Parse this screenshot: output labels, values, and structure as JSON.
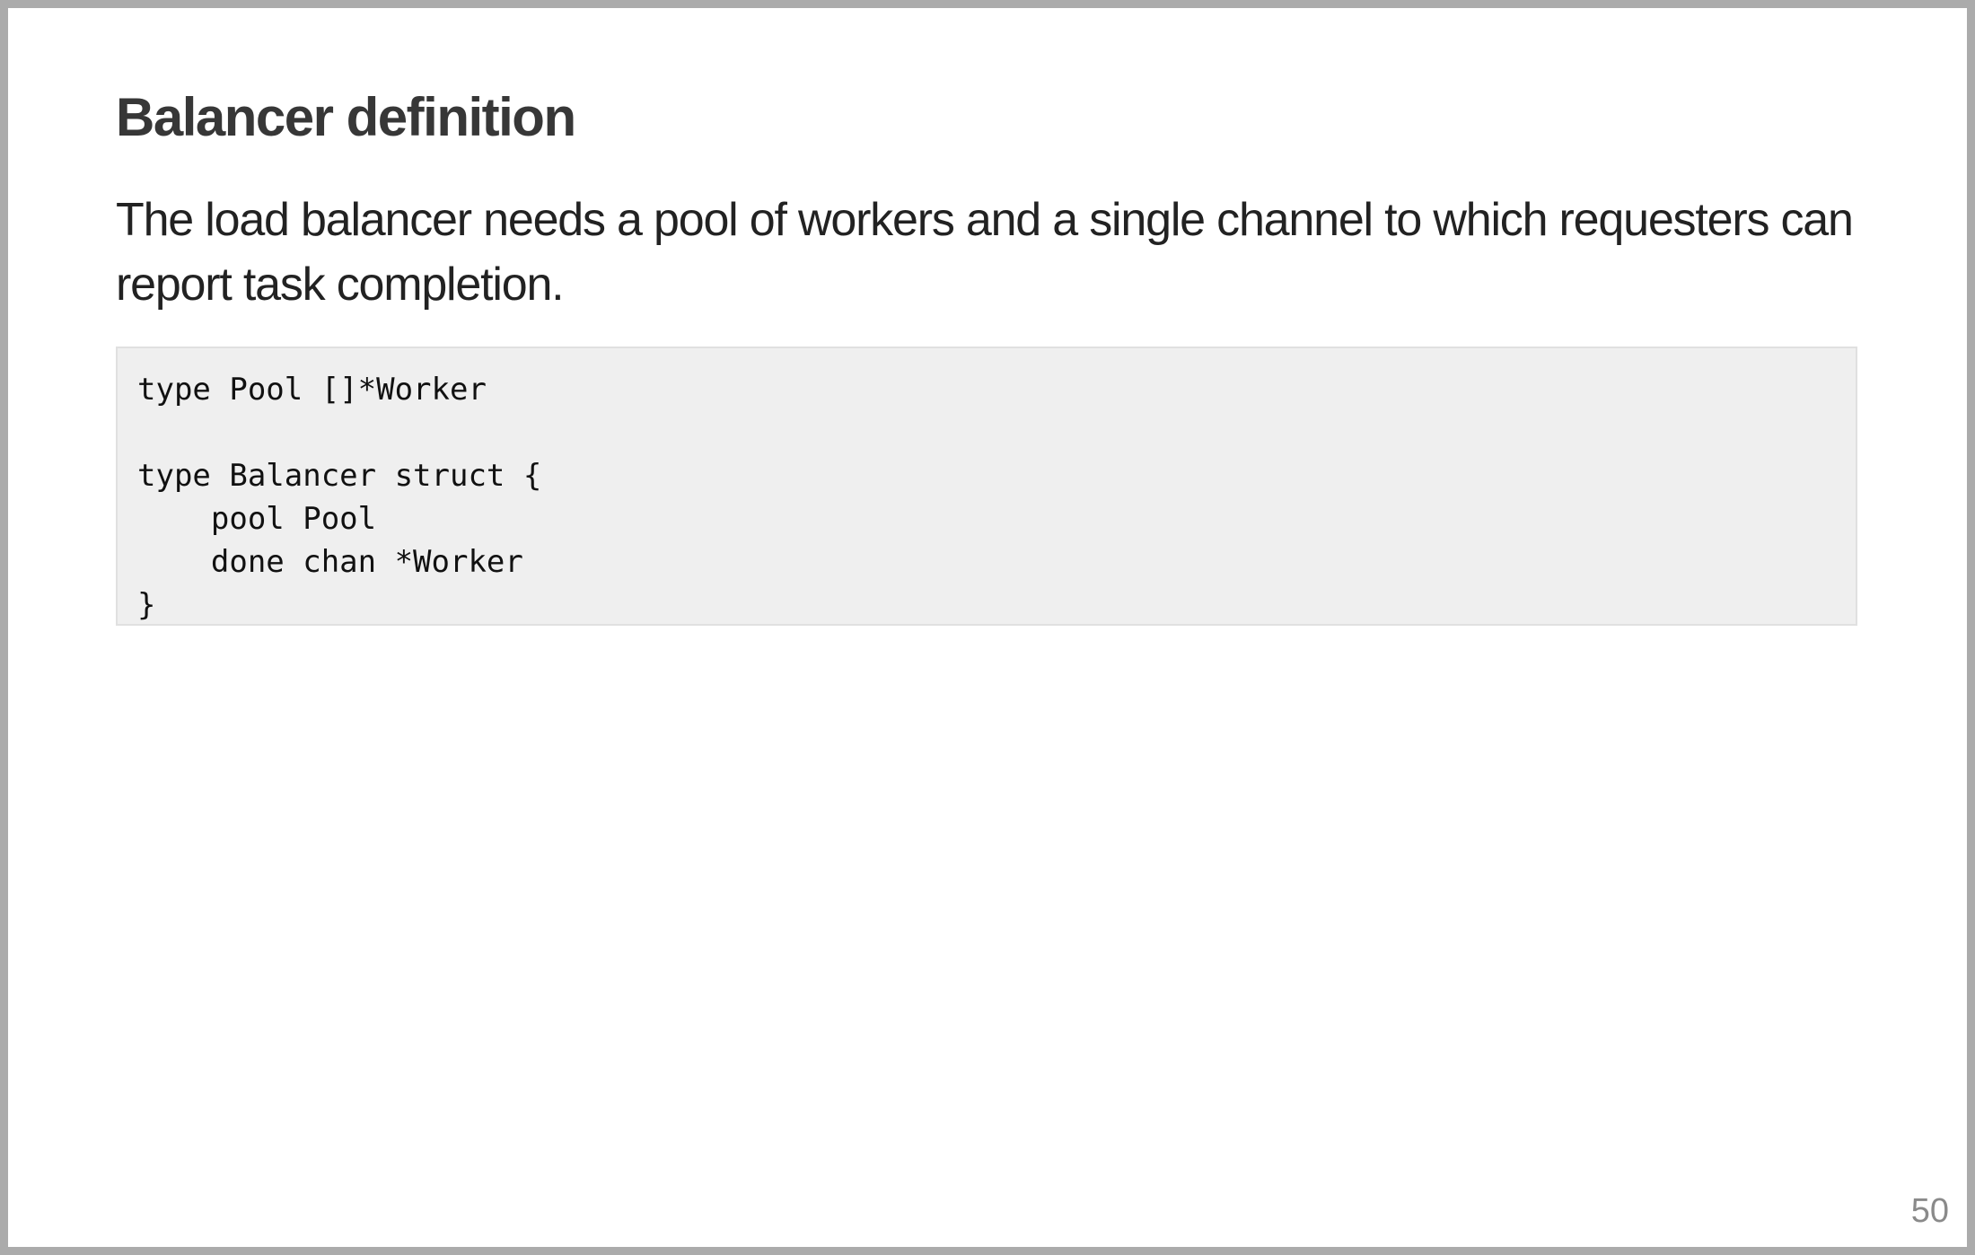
{
  "slide": {
    "title": "Balancer definition",
    "body": "The load balancer needs a pool of workers and a single channel to which requesters can report task completion.",
    "code": "type Pool []*Worker\n\ntype Balancer struct {\n    pool Pool\n    done chan *Worker\n}",
    "page_number": "50"
  }
}
